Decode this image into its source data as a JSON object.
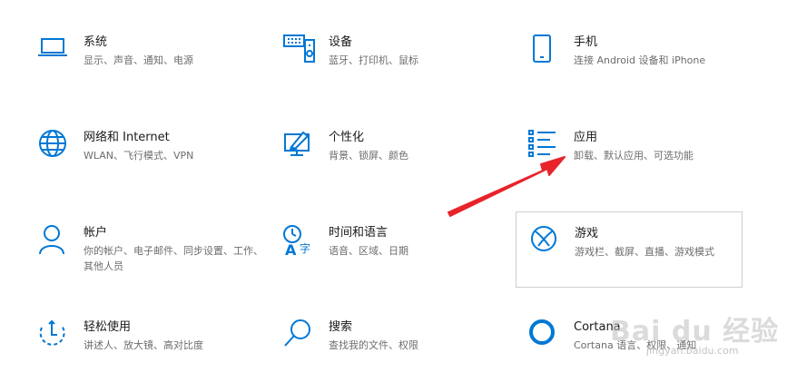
{
  "accent": "#0078d4",
  "arrow_color": "#e8232a",
  "tiles": [
    {
      "title": "系统",
      "desc": "显示、声音、通知、电源",
      "icon": "laptop-icon"
    },
    {
      "title": "设备",
      "desc": "蓝牙、打印机、鼠标",
      "icon": "devices-icon"
    },
    {
      "title": "手机",
      "desc": "连接 Android 设备和 iPhone",
      "icon": "phone-icon"
    },
    {
      "title": "网络和 Internet",
      "desc": "WLAN、飞行模式、VPN",
      "icon": "globe-icon"
    },
    {
      "title": "个性化",
      "desc": "背景、锁屏、颜色",
      "icon": "personalization-icon"
    },
    {
      "title": "应用",
      "desc": "卸载、默认应用、可选功能",
      "icon": "apps-list-icon"
    },
    {
      "title": "帐户",
      "desc": "你的帐户、电子邮件、同步设置、工作、其他人员",
      "icon": "person-icon"
    },
    {
      "title": "时间和语言",
      "desc": "语音、区域、日期",
      "icon": "time-language-icon"
    },
    {
      "title": "游戏",
      "desc": "游戏栏、截屏、直播、游戏模式",
      "icon": "xbox-icon"
    },
    {
      "title": "轻松使用",
      "desc": "讲述人、放大镜、高对比度",
      "icon": "ease-of-access-icon"
    },
    {
      "title": "搜索",
      "desc": "查找我的文件、权限",
      "icon": "search-icon"
    },
    {
      "title": "Cortana",
      "desc": "Cortana 语言、权限、通知",
      "icon": "cortana-icon"
    }
  ],
  "watermark": {
    "text": "Bai du 经验",
    "sub": "jingyan.baidu.com"
  }
}
